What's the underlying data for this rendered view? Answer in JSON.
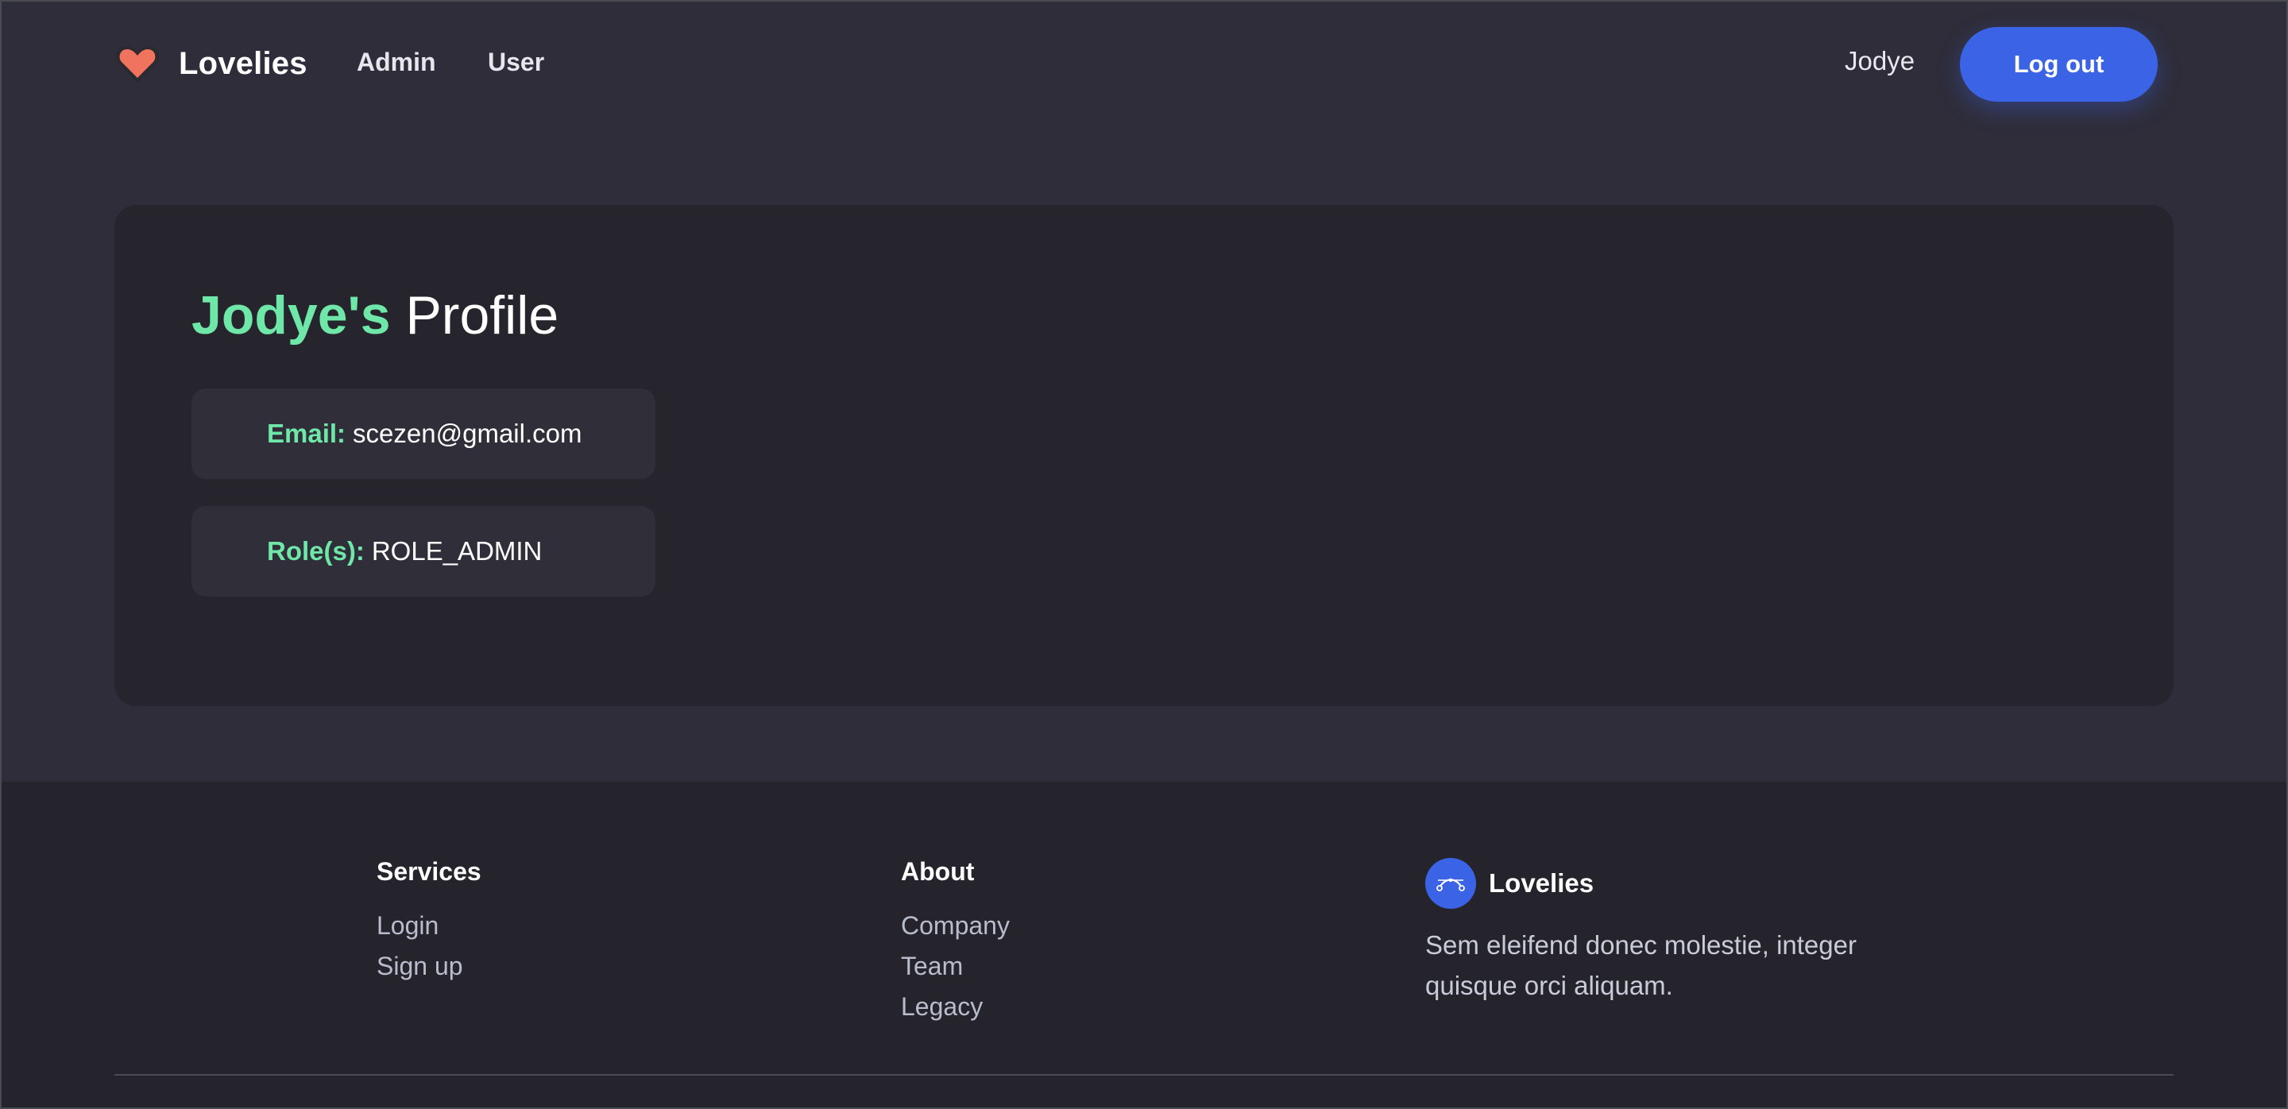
{
  "nav": {
    "brand": "Lovelies",
    "links": [
      "Admin",
      "User"
    ],
    "username": "Jodye",
    "logout_label": "Log out"
  },
  "profile": {
    "title_name": "Jodye's",
    "title_rest": "Profile",
    "email_label": "Email:",
    "email_value": "scezen@gmail.com",
    "roles_label": "Role(s):",
    "roles_value": "ROLE_ADMIN"
  },
  "footer": {
    "services": {
      "heading": "Services",
      "links": [
        "Login",
        "Sign up"
      ]
    },
    "about": {
      "heading": "About",
      "links": [
        "Company",
        "Team",
        "Legacy"
      ]
    },
    "brand": {
      "name": "Lovelies",
      "description": "Sem eleifend donec molestie, integer quisque orci aliquam."
    }
  },
  "colors": {
    "accent_green": "#6ee7a8",
    "primary_blue": "#3b63e6",
    "heart_coral": "#f0735e",
    "background": "#2f2d3a",
    "card": "#26252d",
    "footer": "#25242c"
  },
  "icons": {
    "brand": "heart-icon",
    "footer_logo": "bezier-curve-icon"
  }
}
